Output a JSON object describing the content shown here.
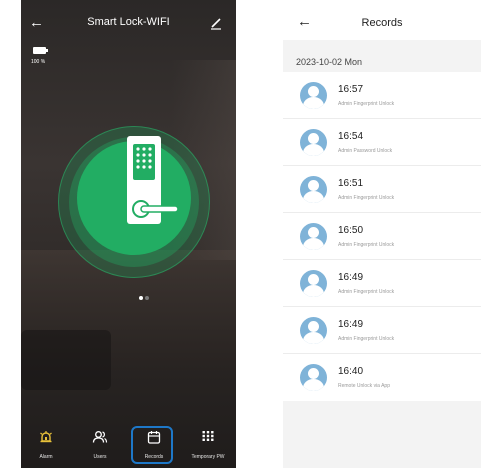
{
  "left_screen": {
    "title": "Smart Lock-WIFI",
    "back_icon": "back-arrow-icon",
    "edit_icon": "pencil-icon",
    "battery_text": "100 %",
    "battery_level": 1.0,
    "lock_color": "#22ad63",
    "page_indicator": {
      "pages": 2,
      "active": 0
    },
    "tabs": [
      {
        "label": "Alarm",
        "icon": "alarm-bell-icon",
        "icon_color": "#e9c23a"
      },
      {
        "label": "Users",
        "icon": "users-icon",
        "icon_color": "#ffffff"
      },
      {
        "label": "Records",
        "icon": "calendar-icon",
        "icon_color": "#ffffff",
        "highlighted": true,
        "highlight_color": "#1e78c8"
      },
      {
        "label": "Temporary PW",
        "icon": "keypad-icon",
        "icon_color": "#ffffff"
      }
    ]
  },
  "right_screen": {
    "title": "Records",
    "back_icon": "back-arrow-icon",
    "date_header": "2023-10-02 Mon",
    "records": [
      {
        "time": "16:57",
        "desc": "Admin Fingerprint Unlock"
      },
      {
        "time": "16:54",
        "desc": "Admin Password Unlock"
      },
      {
        "time": "16:51",
        "desc": "Admin Fingerprint Unlock"
      },
      {
        "time": "16:50",
        "desc": "Admin Fingerprint Unlock"
      },
      {
        "time": "16:49",
        "desc": "Admin Fingerprint Unlock"
      },
      {
        "time": "16:49",
        "desc": "Admin Fingerprint Unlock"
      },
      {
        "time": "16:40",
        "desc": "Remote Unlock via App"
      }
    ],
    "avatar_color": "#7fb3d8"
  }
}
